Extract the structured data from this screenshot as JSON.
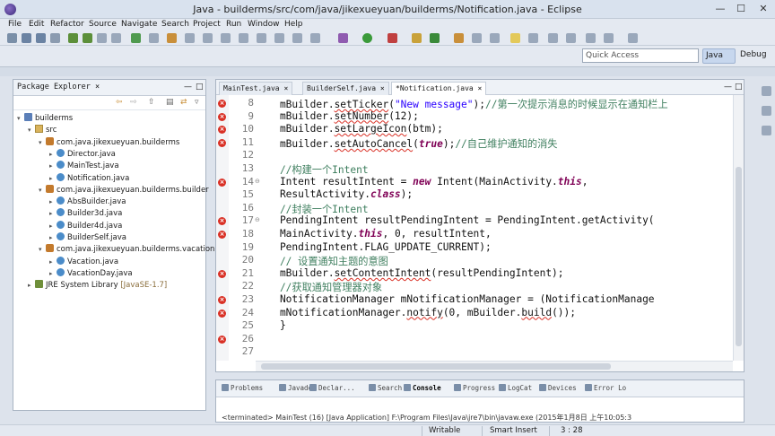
{
  "window": {
    "title": "Java - builderms/src/com/java/jikexueyuan/builderms/Notification.java - Eclipse"
  },
  "menu": [
    "File",
    "Edit",
    "Refactor",
    "Source",
    "Navigate",
    "Search",
    "Project",
    "Run",
    "Window",
    "Help"
  ],
  "quick_access": {
    "placeholder": "Quick Access"
  },
  "perspectives": {
    "java": "Java",
    "debug": "Debug"
  },
  "explorer": {
    "title": "Package Explorer",
    "tree": [
      {
        "label": "builderms",
        "indent": 0,
        "icon": "project",
        "expanded": "▾"
      },
      {
        "label": "src",
        "indent": 1,
        "icon": "src",
        "expanded": "▾"
      },
      {
        "label": "com.java.jikexueyuan.builderms",
        "indent": 2,
        "icon": "package",
        "expanded": "▾"
      },
      {
        "label": "Director.java",
        "indent": 3,
        "icon": "java",
        "expanded": "▸"
      },
      {
        "label": "MainTest.java",
        "indent": 3,
        "icon": "java",
        "expanded": "▸"
      },
      {
        "label": "Notification.java",
        "indent": 3,
        "icon": "java",
        "expanded": "▸"
      },
      {
        "label": "com.java.jikexueyuan.builderms.builder",
        "indent": 2,
        "icon": "package",
        "expanded": "▾"
      },
      {
        "label": "AbsBuilder.java",
        "indent": 3,
        "icon": "java",
        "expanded": "▸"
      },
      {
        "label": "Builder3d.java",
        "indent": 3,
        "icon": "java",
        "expanded": "▸"
      },
      {
        "label": "Builder4d.java",
        "indent": 3,
        "icon": "java",
        "expanded": "▸"
      },
      {
        "label": "BuilderSelf.java",
        "indent": 3,
        "icon": "java",
        "expanded": "▸"
      },
      {
        "label": "com.java.jikexueyuan.builderms.vacation",
        "indent": 2,
        "icon": "package",
        "expanded": "▾"
      },
      {
        "label": "Vacation.java",
        "indent": 3,
        "icon": "java",
        "expanded": "▸"
      },
      {
        "label": "VacationDay.java",
        "indent": 3,
        "icon": "java",
        "expanded": "▸"
      },
      {
        "label": "JRE System Library",
        "indent": 1,
        "icon": "jre",
        "expanded": "▸",
        "tag": "[JavaSE-1.7]"
      }
    ]
  },
  "editor": {
    "tabs": [
      {
        "label": "MainTest.java",
        "active": false
      },
      {
        "label": "BuilderSelf.java",
        "active": false
      },
      {
        "label": "*Notification.java",
        "active": true
      }
    ],
    "lines": [
      {
        "n": "8",
        "err": true,
        "fold": false,
        "parts": [
          [
            "t",
            "    mBuilder."
          ],
          [
            "sq",
            "setTicker"
          ],
          [
            "t",
            "("
          ],
          [
            "str",
            "\"New message\""
          ],
          [
            "t",
            ");"
          ],
          [
            "cm",
            "//第一次提示消息的时候显示在通知栏上"
          ]
        ]
      },
      {
        "n": "9",
        "err": true,
        "fold": false,
        "parts": [
          [
            "t",
            "    mBuilder."
          ],
          [
            "sq",
            "setNumber"
          ],
          [
            "t",
            "(12);"
          ]
        ]
      },
      {
        "n": "10",
        "err": true,
        "fold": false,
        "parts": [
          [
            "t",
            "    mBuilder."
          ],
          [
            "sq",
            "setLargeIcon"
          ],
          [
            "t",
            "(btm);"
          ]
        ]
      },
      {
        "n": "11",
        "err": true,
        "fold": false,
        "parts": [
          [
            "t",
            "    mBuilder."
          ],
          [
            "sq",
            "setAutoCancel"
          ],
          [
            "t",
            "("
          ],
          [
            "kw",
            "true"
          ],
          [
            "t",
            ");"
          ],
          [
            "cm",
            "//自己维护通知的消失"
          ]
        ]
      },
      {
        "n": "12",
        "err": false,
        "fold": false,
        "parts": []
      },
      {
        "n": "13",
        "err": false,
        "fold": false,
        "parts": [
          [
            "cm",
            "    //构建一个Intent"
          ]
        ]
      },
      {
        "n": "14",
        "err": true,
        "fold": true,
        "parts": [
          [
            "t",
            "    Intent resultIntent = "
          ],
          [
            "kw",
            "new"
          ],
          [
            "t",
            " Intent(MainActivity."
          ],
          [
            "kw",
            "this"
          ],
          [
            "t",
            ","
          ]
        ]
      },
      {
        "n": "15",
        "err": false,
        "fold": false,
        "parts": [
          [
            "t",
            "    ResultActivity."
          ],
          [
            "kw",
            "class"
          ],
          [
            "t",
            ");"
          ]
        ]
      },
      {
        "n": "16",
        "err": false,
        "fold": false,
        "parts": [
          [
            "cm",
            "    //封装一个Intent"
          ]
        ]
      },
      {
        "n": "17",
        "err": true,
        "fold": true,
        "parts": [
          [
            "t",
            "    PendingIntent resultPendingIntent = "
          ],
          [
            "t",
            "PendingIntent.getActivity("
          ]
        ]
      },
      {
        "n": "18",
        "err": true,
        "fold": false,
        "parts": [
          [
            "t",
            "    MainActivity."
          ],
          [
            "kw",
            "this"
          ],
          [
            "t",
            ", 0, resultIntent,"
          ]
        ]
      },
      {
        "n": "19",
        "err": false,
        "fold": false,
        "parts": [
          [
            "t",
            "    PendingIntent.FLAG_UPDATE_CURRENT);"
          ]
        ]
      },
      {
        "n": "20",
        "err": false,
        "fold": false,
        "parts": [
          [
            "cm",
            "    // 设置通知主题的意图"
          ]
        ]
      },
      {
        "n": "21",
        "err": true,
        "fold": false,
        "parts": [
          [
            "t",
            "    mBuilder."
          ],
          [
            "sq",
            "setContentIntent"
          ],
          [
            "t",
            "(resultPendingIntent);"
          ]
        ]
      },
      {
        "n": "22",
        "err": false,
        "fold": false,
        "parts": [
          [
            "cm",
            "    //获取通知管理器对象"
          ]
        ]
      },
      {
        "n": "23",
        "err": true,
        "fold": false,
        "parts": [
          [
            "t",
            "    NotificationManager mNotificationManager = (NotificationManage"
          ]
        ]
      },
      {
        "n": "24",
        "err": true,
        "fold": false,
        "parts": [
          [
            "t",
            "    mNotificationManager."
          ],
          [
            "sq",
            "notify"
          ],
          [
            "t",
            "(0, mBuilder."
          ],
          [
            "sq",
            "build"
          ],
          [
            "t",
            "());"
          ]
        ]
      },
      {
        "n": "25",
        "err": false,
        "fold": false,
        "parts": [
          [
            "t",
            "    }"
          ]
        ]
      },
      {
        "n": "26",
        "err": true,
        "fold": false,
        "parts": []
      },
      {
        "n": "27",
        "err": false,
        "fold": false,
        "parts": []
      }
    ]
  },
  "bottom": {
    "tabs": [
      {
        "label": "Problems",
        "active": false
      },
      {
        "label": "Javadoc",
        "active": false
      },
      {
        "label": "Declar...",
        "active": false
      },
      {
        "label": "Search",
        "active": false
      },
      {
        "label": "Console",
        "active": true
      },
      {
        "label": "Progress",
        "active": false
      },
      {
        "label": "LogCat",
        "active": false
      },
      {
        "label": "Devices",
        "active": false
      },
      {
        "label": "Error Lo",
        "active": false
      }
    ],
    "console_text": "<terminated> MainTest (16) [Java Application] F:\\Program Files\\Java\\jre7\\bin\\javaw.exe (2015年1月8日 上午10:05:3"
  },
  "status": {
    "writable": "Writable",
    "insert_mode": "Smart Insert",
    "position": "3 : 28"
  }
}
